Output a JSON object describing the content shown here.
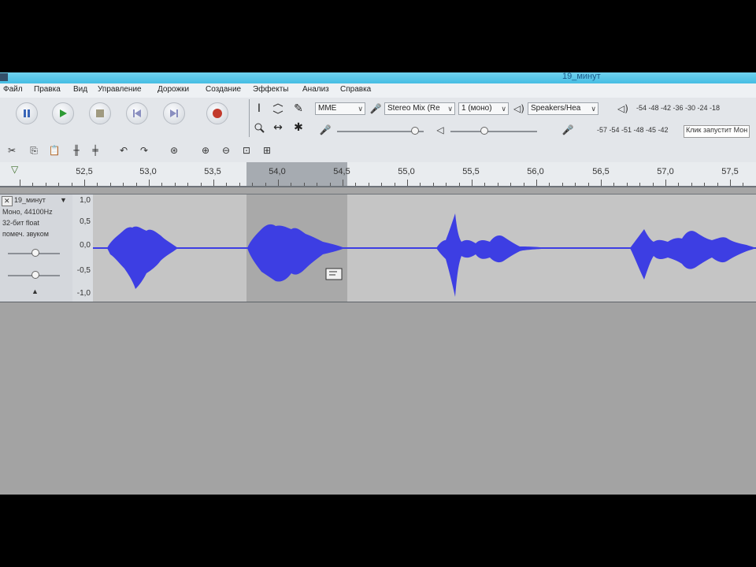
{
  "window": {
    "title": "19_минут"
  },
  "menu": [
    "Файл",
    "Правка",
    "Вид",
    "Управление",
    "Дорожки",
    "Создание",
    "Эффекты",
    "Анализ",
    "Справка"
  ],
  "transport": [
    "pause-icon",
    "play-icon",
    "stop-icon",
    "skip-start-icon",
    "skip-end-icon",
    "record-icon"
  ],
  "devices": {
    "host": "MME",
    "input": "Stereo Mix (Re",
    "channels": "1 (моно)",
    "output": "Speakers/Hea"
  },
  "meters": {
    "record_scale": "-54 -48 -42 -36 -30 -24 -18",
    "play_scale": "-57 -54 -51 -48 -45 -42",
    "record_hint": "Клик запустит Мон"
  },
  "ruler": {
    "labels": [
      "52,5",
      "53,0",
      "53,5",
      "54,0",
      "54,5",
      "55,0",
      "55,5",
      "56,0",
      "56,5",
      "57,0",
      "57,5"
    ]
  },
  "track": {
    "name": "19_минут",
    "info": [
      "Моно, 44100Hz",
      "32-бит float",
      "помеч. звуком"
    ],
    "scale": [
      "1,0",
      "0,5",
      "0,0",
      "-0,5",
      "-1,0"
    ]
  },
  "colors": {
    "waveform": "#3d3ee3",
    "selection": "#a9a9a9",
    "titlebar": "#46bde3"
  }
}
